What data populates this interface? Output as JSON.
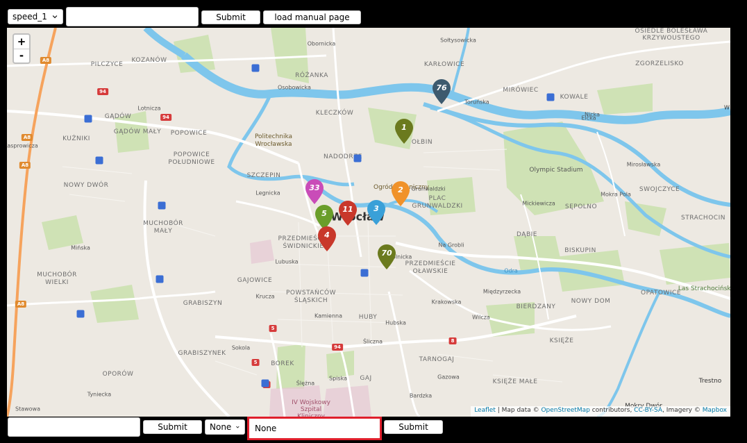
{
  "top_controls": {
    "speed_select": "speed_1",
    "text_value": "",
    "submit_label": "Submit",
    "manual_label": "load manual page"
  },
  "bottom_controls": {
    "text_value": "",
    "submit_label": "Submit",
    "none_select": "None",
    "highlighted_value": "None",
    "submit2_label": "Submit"
  },
  "map": {
    "zoom_in": "+",
    "zoom_out": "-",
    "attribution": {
      "leaflet": "Leaflet",
      "sep1": " | Map data © ",
      "osm": "OpenStreetMap",
      "mid": " contributors, ",
      "license": "CC-BY-SA",
      "imagery": ", Imagery © ",
      "mapbox": "Mapbox"
    },
    "city_label": "Wrocław",
    "district_labels": [
      "PILCZYCE",
      "KOZANÓW",
      "GĄDÓW",
      "GĄDÓW MAŁY",
      "KUŹNIKI",
      "POPOWICE",
      "POPOWICE POŁUDNIOWE",
      "NOWY DWÓR",
      "SZCZEPIN",
      "MUCHOBÓR MAŁY",
      "MUCHOBÓR WIELKI",
      "GAJOWICE",
      "GRABISZYN",
      "POWSTAŃCÓW ŚLĄSKICH",
      "GRABISZYNEK",
      "BOREK",
      "OPORÓW",
      "RÓŻANKA",
      "KARŁOWICE",
      "KLECZKÓW",
      "NADODRZE",
      "OŁBIN",
      "PLAC GRUNWALDZKI",
      "MIRÓWIEC",
      "KOWALE",
      "ZGORZELISKO",
      "OSIEDLE BOLESŁAWA KRZYWOUSTEGO",
      "SĘPOLNO",
      "DĄBIE",
      "BISKUPIN",
      "SWOJCZYCE",
      "STRACHOCIN",
      "OPATOWICE",
      "NOWY DOM",
      "BIERDZANY",
      "KSIĘŻE",
      "KSIĘŻE MAŁE",
      "PRZEDMIEŚCIE OŁAWSKIE",
      "PRZEDMIEŚCIE ŚWIDNICKIE",
      "HUBY",
      "GAJ",
      "TARNOGAJ"
    ],
    "poi_labels": [
      "Politechnika Wrocławska",
      "Ogród Botaniczny",
      "Olympic Stadium",
      "Las Strachociński",
      "IV Wojskowy Szpital Kliniczny",
      "Trestno",
      "Mokry Dwór"
    ],
    "street_labels": [
      "Osobowicka",
      "Toruńska",
      "Lotnicza",
      "Legnicka",
      "Lubuska",
      "Krucza",
      "Kamienna",
      "Sokola",
      "Ślężna",
      "Hubska",
      "Śliczna",
      "Gazowa",
      "Krakowska",
      "Na Grobli",
      "Międzyrzecka",
      "Wilcza",
      "Odra",
      "Mińska",
      "Tyniecka",
      "Stawowa",
      "Sołtysowicka",
      "Kasprowicza",
      "Obornicka",
      "Mickiewicza",
      "Elcka",
      "Mirosławska",
      "Mokra Pola",
      "Bardzka",
      "Spiska",
      "Pl. Grunwaldzki",
      "Sokolnicka",
      "Nicka",
      "W"
    ],
    "road_shields": [
      "A8",
      "A8",
      "A8",
      "A8",
      "94",
      "94",
      "94",
      "5",
      "5",
      "5",
      "8"
    ],
    "markers": [
      {
        "label": "76",
        "color": "#3d5a6e"
      },
      {
        "label": "1",
        "color": "#6b7a1e"
      },
      {
        "label": "33",
        "color": "#c94cb8"
      },
      {
        "label": "2",
        "color": "#f0922a"
      },
      {
        "label": "11",
        "color": "#c8382b"
      },
      {
        "label": "3",
        "color": "#3aa0d8"
      },
      {
        "label": "5",
        "color": "#6a9e2a"
      },
      {
        "label": "4",
        "color": "#c8382b"
      },
      {
        "label": "70",
        "color": "#6b7a1e"
      }
    ]
  }
}
